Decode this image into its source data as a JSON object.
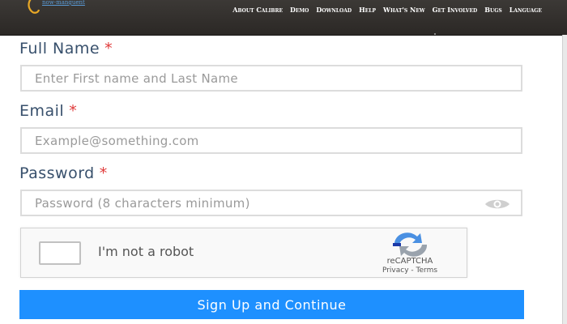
{
  "header": {
    "logo_text": "now-manguent",
    "nav": [
      {
        "label": "About Calibre"
      },
      {
        "label": "Demo"
      },
      {
        "label": "Download"
      },
      {
        "label": "Help"
      },
      {
        "label": "What's New"
      },
      {
        "label": "Get Involved"
      },
      {
        "label": "Bugs"
      },
      {
        "label": "Language"
      }
    ]
  },
  "form": {
    "full_name": {
      "label": "Full Name",
      "required": "*",
      "placeholder": "Enter First name and Last Name",
      "value": ""
    },
    "email": {
      "label": "Email",
      "required": "*",
      "placeholder": "Example@something.com",
      "value": ""
    },
    "password": {
      "label": "Password",
      "required": "*",
      "placeholder": "Password (8 characters minimum)",
      "value": "",
      "toggle_icon": "eye-icon"
    },
    "captcha": {
      "text": "I'm not a robot",
      "brand": "reCAPTCHA",
      "privacy": "Privacy",
      "separator": " - ",
      "terms": "Terms",
      "checked": false
    },
    "submit_label": "Sign Up and Continue"
  },
  "colors": {
    "header_bg": "#2f2c29",
    "label": "#38506c",
    "required": "#e03a3a",
    "button": "#1e90ff"
  }
}
